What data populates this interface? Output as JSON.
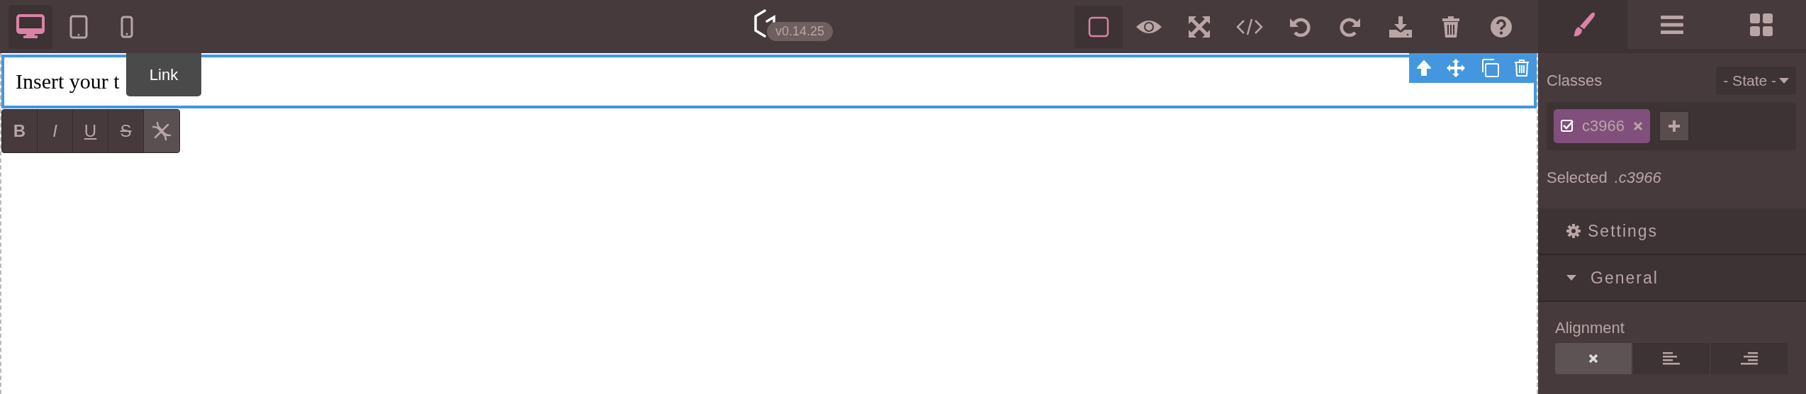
{
  "devices": [
    {
      "selected": true
    },
    {
      "selected": false
    },
    {
      "selected": false
    }
  ],
  "logo": {
    "version": "v0.14.25"
  },
  "options": [
    {
      "active": true
    },
    {
      "active": false
    },
    {
      "active": false
    },
    {
      "active": false
    },
    {
      "active": false
    },
    {
      "active": false
    },
    {
      "active": false
    },
    {
      "active": false
    },
    {
      "active": false
    }
  ],
  "views": [
    {
      "selected": true
    },
    {
      "selected": false
    },
    {
      "selected": false
    }
  ],
  "canvas": {
    "text": "Insert your t"
  },
  "tooltip": "Link",
  "rte_buttons": [
    {
      "kind": "text",
      "label": "B",
      "active": false
    },
    {
      "kind": "text",
      "label": "I",
      "active": false
    },
    {
      "kind": "text",
      "label": "U",
      "active": false
    },
    {
      "kind": "text",
      "label": "S",
      "active": false
    },
    {
      "kind": "link",
      "active": true
    }
  ],
  "classes": {
    "label": "Classes",
    "state": "- State -",
    "tags": [
      {
        "label": "c3966",
        "checked": true
      }
    ],
    "selected_label": "Selected",
    "selected_value": ".c3966"
  },
  "settings": {
    "title": "Settings"
  },
  "sectors": [
    {
      "title": "General",
      "expanded": true,
      "properties": [
        {
          "label": "Alignment",
          "options": [
            {
              "selected": true
            },
            {
              "selected": false
            },
            {
              "selected": false
            }
          ]
        }
      ]
    }
  ]
}
